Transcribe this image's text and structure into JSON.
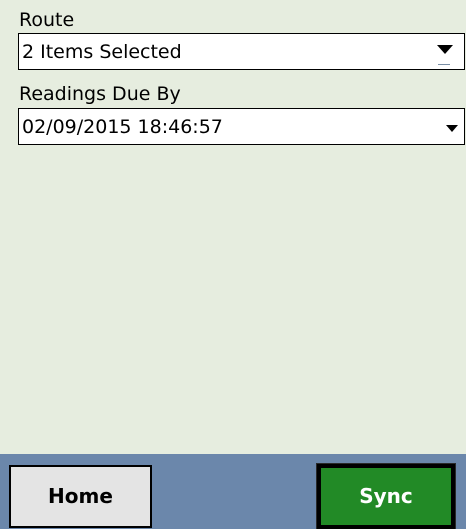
{
  "form": {
    "route_label": "Route",
    "route_value": "2 Items Selected",
    "readings_label": "Readings Due By",
    "readings_value": "02/09/2015 18:46:57"
  },
  "toolbar": {
    "home_label": "Home",
    "sync_label": "Sync"
  },
  "colors": {
    "background": "#e6eddf",
    "toolbar": "#6b87ab",
    "sync_button": "#228a26",
    "home_button": "#e4e4e4"
  },
  "icons": {
    "route_dropdown": "triangle-down-icon",
    "date_dropdown": "triangle-down-icon"
  }
}
